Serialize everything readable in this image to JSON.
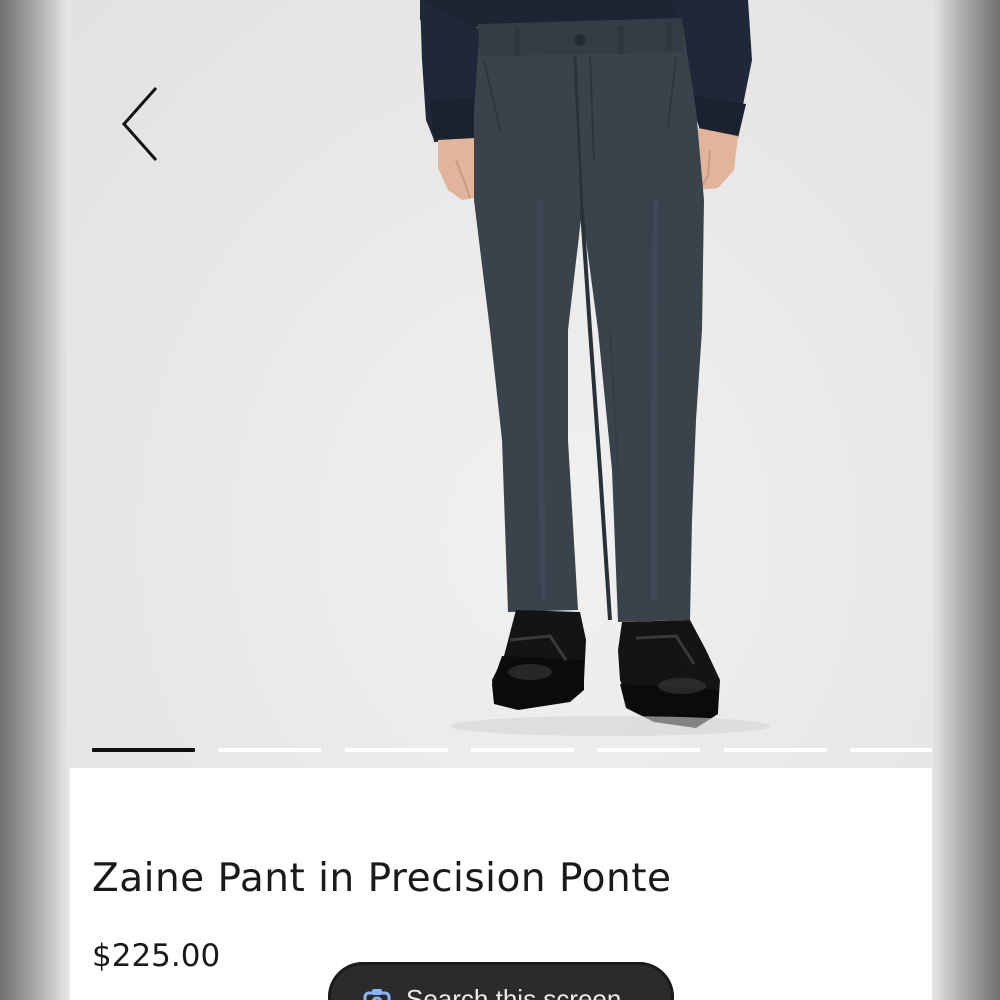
{
  "product": {
    "title": "Zaine Pant in Precision Ponte",
    "price": "$225.00",
    "pant_color": "#3a434c"
  },
  "gallery": {
    "image_count": 7,
    "active_index": 0,
    "back_icon": "chevron-left-icon"
  },
  "assistant": {
    "search_label": "Search this screen",
    "icon": "lens-search-icon",
    "accent": "#8ab4f8"
  }
}
